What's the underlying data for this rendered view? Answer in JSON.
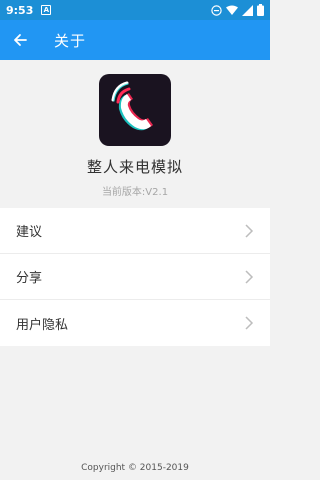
{
  "status_bar": {
    "time": "9:53",
    "notification": "A"
  },
  "app_bar": {
    "title": "关于"
  },
  "app_info": {
    "name": "整人来电模拟",
    "version": "当前版本:V2.1"
  },
  "menu": {
    "items": [
      {
        "label": "建议"
      },
      {
        "label": "分享"
      },
      {
        "label": "用户隐私"
      }
    ]
  },
  "footer": {
    "copyright": "Copyright © 2015-2019"
  },
  "colors": {
    "status_bar": "#1c8fd6",
    "app_bar": "#2196f3",
    "background": "#f2f2f2"
  }
}
